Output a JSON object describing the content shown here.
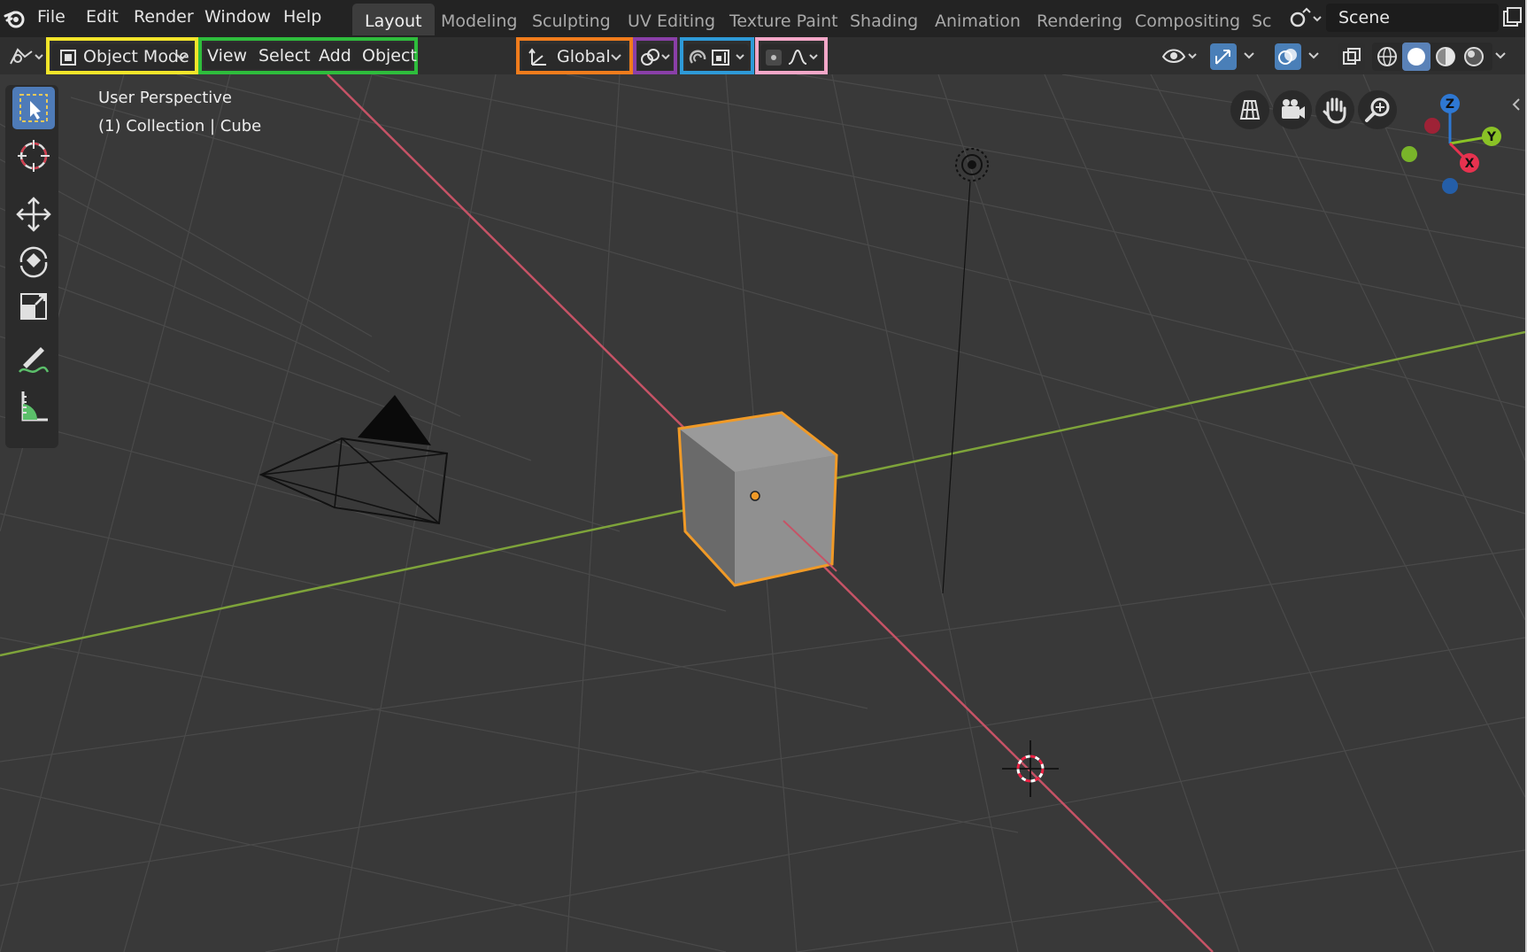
{
  "app": {
    "name": "Blender"
  },
  "topbar": {
    "menus": [
      "File",
      "Edit",
      "Render",
      "Window",
      "Help"
    ],
    "workspace_tabs": [
      {
        "label": "Layout",
        "active": true
      },
      {
        "label": "Modeling",
        "active": false
      },
      {
        "label": "Sculpting",
        "active": false
      },
      {
        "label": "UV Editing",
        "active": false
      },
      {
        "label": "Texture Paint",
        "active": false
      },
      {
        "label": "Shading",
        "active": false
      },
      {
        "label": "Animation",
        "active": false
      },
      {
        "label": "Rendering",
        "active": false
      },
      {
        "label": "Compositing",
        "active": false
      },
      {
        "label": "Sc",
        "active": false
      }
    ],
    "scene_name": "Scene"
  },
  "header": {
    "mode_label": "Object Mode",
    "menus": [
      "View",
      "Select",
      "Add",
      "Object"
    ],
    "transform_orientation": "Global",
    "highlight_colors": {
      "mode": "#f2e52a",
      "menus": "#2ebd3c",
      "orientation": "#f07c1c",
      "pivot": "#8a3fa8",
      "snap": "#2e9ad8",
      "proportional": "#f3a7c8"
    }
  },
  "viewport": {
    "view_label": "User Perspective",
    "collection_label": "(1) Collection | Cube",
    "selected_object": "Cube",
    "selection_outline_color": "#f09a27",
    "x_axis_color": "#c65366",
    "y_axis_color": "#7ea33a"
  },
  "gizmo": {
    "axes": [
      "Z",
      "Y",
      "X"
    ],
    "colors": {
      "x": "#e7324f",
      "y": "#8ac226",
      "z": "#2e78d3"
    }
  },
  "icons": {
    "left_toolbar": [
      "select-box-icon",
      "cursor-icon",
      "move-icon",
      "rotate-icon",
      "scale-icon",
      "annotate-icon",
      "measure-icon"
    ],
    "nav": [
      "grid-view-icon",
      "camera-view-icon",
      "pan-hand-icon",
      "zoom-icon"
    ]
  }
}
